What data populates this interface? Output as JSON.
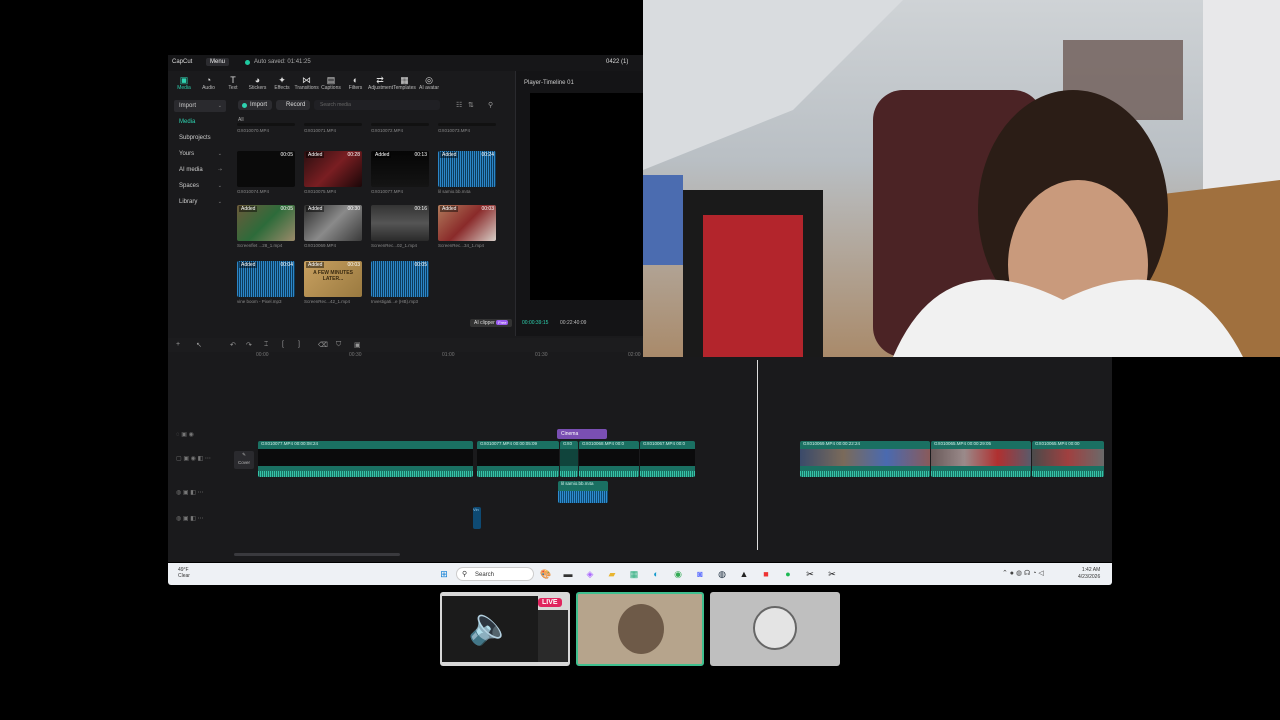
{
  "app": {
    "name": "CapCut",
    "menu": "Menu",
    "autosave": "Auto saved: 01:41:25",
    "project_code": "0422 (1)"
  },
  "tools": [
    {
      "label": "Media",
      "icon": "media-icon"
    },
    {
      "label": "Audio",
      "icon": "audio-icon"
    },
    {
      "label": "Text",
      "icon": "text-icon"
    },
    {
      "label": "Stickers",
      "icon": "stickers-icon"
    },
    {
      "label": "Effects",
      "icon": "effects-icon"
    },
    {
      "label": "Transitions",
      "icon": "transitions-icon"
    },
    {
      "label": "Captions",
      "icon": "captions-icon"
    },
    {
      "label": "Filters",
      "icon": "filters-icon"
    },
    {
      "label": "Adjustment",
      "icon": "adjustment-icon"
    },
    {
      "label": "Templates",
      "icon": "templates-icon"
    },
    {
      "label": "AI avatar",
      "icon": "ai-avatar-icon"
    }
  ],
  "sidebar": [
    "Import",
    "Media",
    "Subprojects",
    "Yours",
    "AI media",
    "Spaces",
    "Library"
  ],
  "media_toolbar": {
    "import": "Import",
    "record": "Record",
    "search_placeholder": "Search media",
    "filter_all": "All"
  },
  "media_items": [
    {
      "caption": "GX010070.MP4",
      "added": "",
      "duration": ""
    },
    {
      "caption": "GX010071.MP4",
      "added": "",
      "duration": ""
    },
    {
      "caption": "GX010072.MP4",
      "added": "",
      "duration": ""
    },
    {
      "caption": "GX010073.MP4",
      "added": "",
      "duration": ""
    },
    {
      "caption": "GX010074.MP4",
      "added": "",
      "duration": "00:05"
    },
    {
      "caption": "GX010075.MP4",
      "added": "Added",
      "duration": "00:28"
    },
    {
      "caption": "GX010077.MP4",
      "added": "Added",
      "duration": "00:13"
    },
    {
      "caption": "lil samio.bb.m4a",
      "added": "Added",
      "duration": "00:24"
    },
    {
      "caption": "Screenflet ...28_1.mp4",
      "added": "Added",
      "duration": "00:05"
    },
    {
      "caption": "GX010069.MP4",
      "added": "Added",
      "duration": "00:30"
    },
    {
      "caption": "ScreenRec...02_1.mp4",
      "added": "",
      "duration": "00:16"
    },
    {
      "caption": "ScreenRec...34_1.mp4",
      "added": "Added",
      "duration": "00:03"
    },
    {
      "caption": "vine boom - Pixel.mp3",
      "added": "Added",
      "duration": "00:04"
    },
    {
      "caption": "ScreenRec...42_1.mp4",
      "added": "Added",
      "duration": "00:03"
    },
    {
      "caption": "Investigati...e (HB).mp3",
      "added": "",
      "duration": "00:05"
    }
  ],
  "thumb_text": "A FEW MINUTES LATER...",
  "ai_clipper": "AI clipper",
  "ai_clipper_badge": "Free",
  "player": {
    "title": "Player-Timeline 01",
    "current": "00:00:39:15",
    "total": "00:22:40:09"
  },
  "timeline": {
    "ruler": [
      "00:00",
      "00:30",
      "01:00",
      "01:30",
      "02:00"
    ],
    "cover_label": "Cover",
    "text_clip": "Cinema",
    "audio_clip": "lil samio.bb.m4a",
    "small_clip": "Vin",
    "video_labels": [
      "GX010077.MP4  00:00:08:24",
      "GX010077.MP4  00:00:05:09",
      "GX0",
      "GX010068.MP4  00:0",
      "GX010067.MP4  00:0",
      "GX010069.MP4  00:00:22:24",
      "GX010065.MP4  00:00:29:05",
      "GX010065.MP4  00:00"
    ]
  },
  "taskbar": {
    "weather_temp": "49°F",
    "weather_desc": "Clear",
    "search": "Search",
    "time": "1:42 AM",
    "date": "4/23/2026"
  },
  "stream": {
    "live_badge": "LIVE"
  },
  "colors": {
    "accent": "#2ed3b0",
    "clip": "#1a7062",
    "live": "#e0245e",
    "text_clip": "#7a4fb3"
  }
}
